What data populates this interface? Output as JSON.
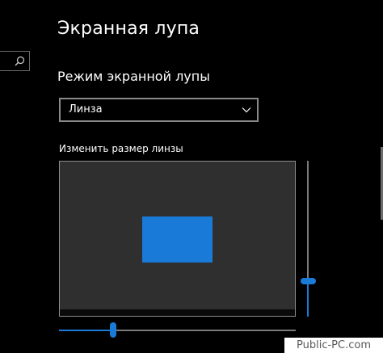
{
  "header": {
    "title": "Экранная лупа"
  },
  "sidebar": {
    "search_icon": "search-icon"
  },
  "mode": {
    "heading": "Режим экранной лупы",
    "dropdown": {
      "selected": "Линза",
      "icon": "chevron-down-icon"
    }
  },
  "lens": {
    "label": "Изменить размер линзы",
    "width_level": 0.23,
    "height_level": 0.23
  },
  "watermark": {
    "text": "Public-PC.com"
  },
  "colors": {
    "background": "#000000",
    "accent": "#1a7ad8",
    "preview": "#2f2f2f"
  }
}
